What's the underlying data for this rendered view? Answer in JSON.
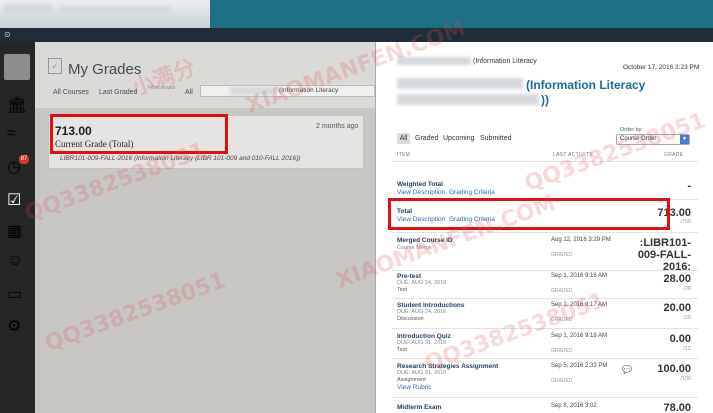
{
  "browser": {
    "accent_color": "#1d6f83"
  },
  "left_panel": {
    "title": "My Grades",
    "filters": {
      "all_courses": "All Courses",
      "last_graded": "Last Graded",
      "filter_label": "Filter results",
      "all": "All",
      "search_value": "(Information Literacy"
    },
    "card": {
      "grade": "713.00",
      "label": "Current Grade (Total)",
      "time": "2 months ago",
      "course": "LIBR101-009-FALL-2016 (Information Literacy (LIBR 101-009 and 010-FALL 2016))"
    }
  },
  "right_panel": {
    "breadcrumb": "(Information Literacy",
    "date": "October 17, 2016 3:23 PM",
    "title_line1": "(Information Literacy",
    "title_line2": "))",
    "tabs": [
      "All",
      "Graded",
      "Upcoming",
      "Submitted"
    ],
    "order_label": "Order by:",
    "order_value": "Course Order",
    "headers": {
      "item": "ITEM",
      "activity": "LAST ACTIVITY",
      "grade": "GRADE"
    },
    "rows": [
      {
        "title": "Weighted Total",
        "links": [
          "View Description",
          "Grading Criteria"
        ],
        "grade": "-"
      },
      {
        "title": "Total",
        "links": [
          "View Description",
          "Grading Criteria"
        ],
        "grade": "713.00",
        "max": "/760"
      },
      {
        "title": "Merged Course ID",
        "sub": "Course Merge",
        "activity": "Aug 12, 2016 3:29 PM",
        "status": "GRADED",
        "grade": ":LIBR101-009-FALL-2016:"
      },
      {
        "title": "Pre-test",
        "sub": "DUE: AUG 24, 2016",
        "type": "Test",
        "activity": "Sep 1, 2016 9:16 AM",
        "status": "GRADED",
        "grade": "28.00",
        "max": "/28"
      },
      {
        "title": "Student Introductions",
        "sub": "DUE: AUG 24, 2016",
        "type": "Discussion",
        "activity": "Sep 1, 2016 9:17 AM",
        "status": "GRADED",
        "grade": "20.00",
        "max": "/20"
      },
      {
        "title": "Introduction Quiz",
        "sub": "DUE: AUG 31, 2016",
        "type": "Test",
        "activity": "Sep 1, 2016 9:18 AM",
        "status": "GRADED",
        "grade": "0.00",
        "max": "/12"
      },
      {
        "title": "Research Strategies Assignment",
        "sub": "DUE: AUG 31, 2016",
        "type": "Assignment",
        "link": "View Rubric",
        "activity": "Sep 5, 2016 2:33 PM",
        "status": "GRADED",
        "grade": "100.00",
        "max": "/100"
      },
      {
        "title": "Midterm Exam",
        "activity": "Sep 8, 2016 3:02",
        "grade": "78.00"
      }
    ]
  },
  "watermark": {
    "text1": "XIAOMANFEN.COM",
    "text2": "QQ3382538051",
    "text3": "小满分"
  }
}
